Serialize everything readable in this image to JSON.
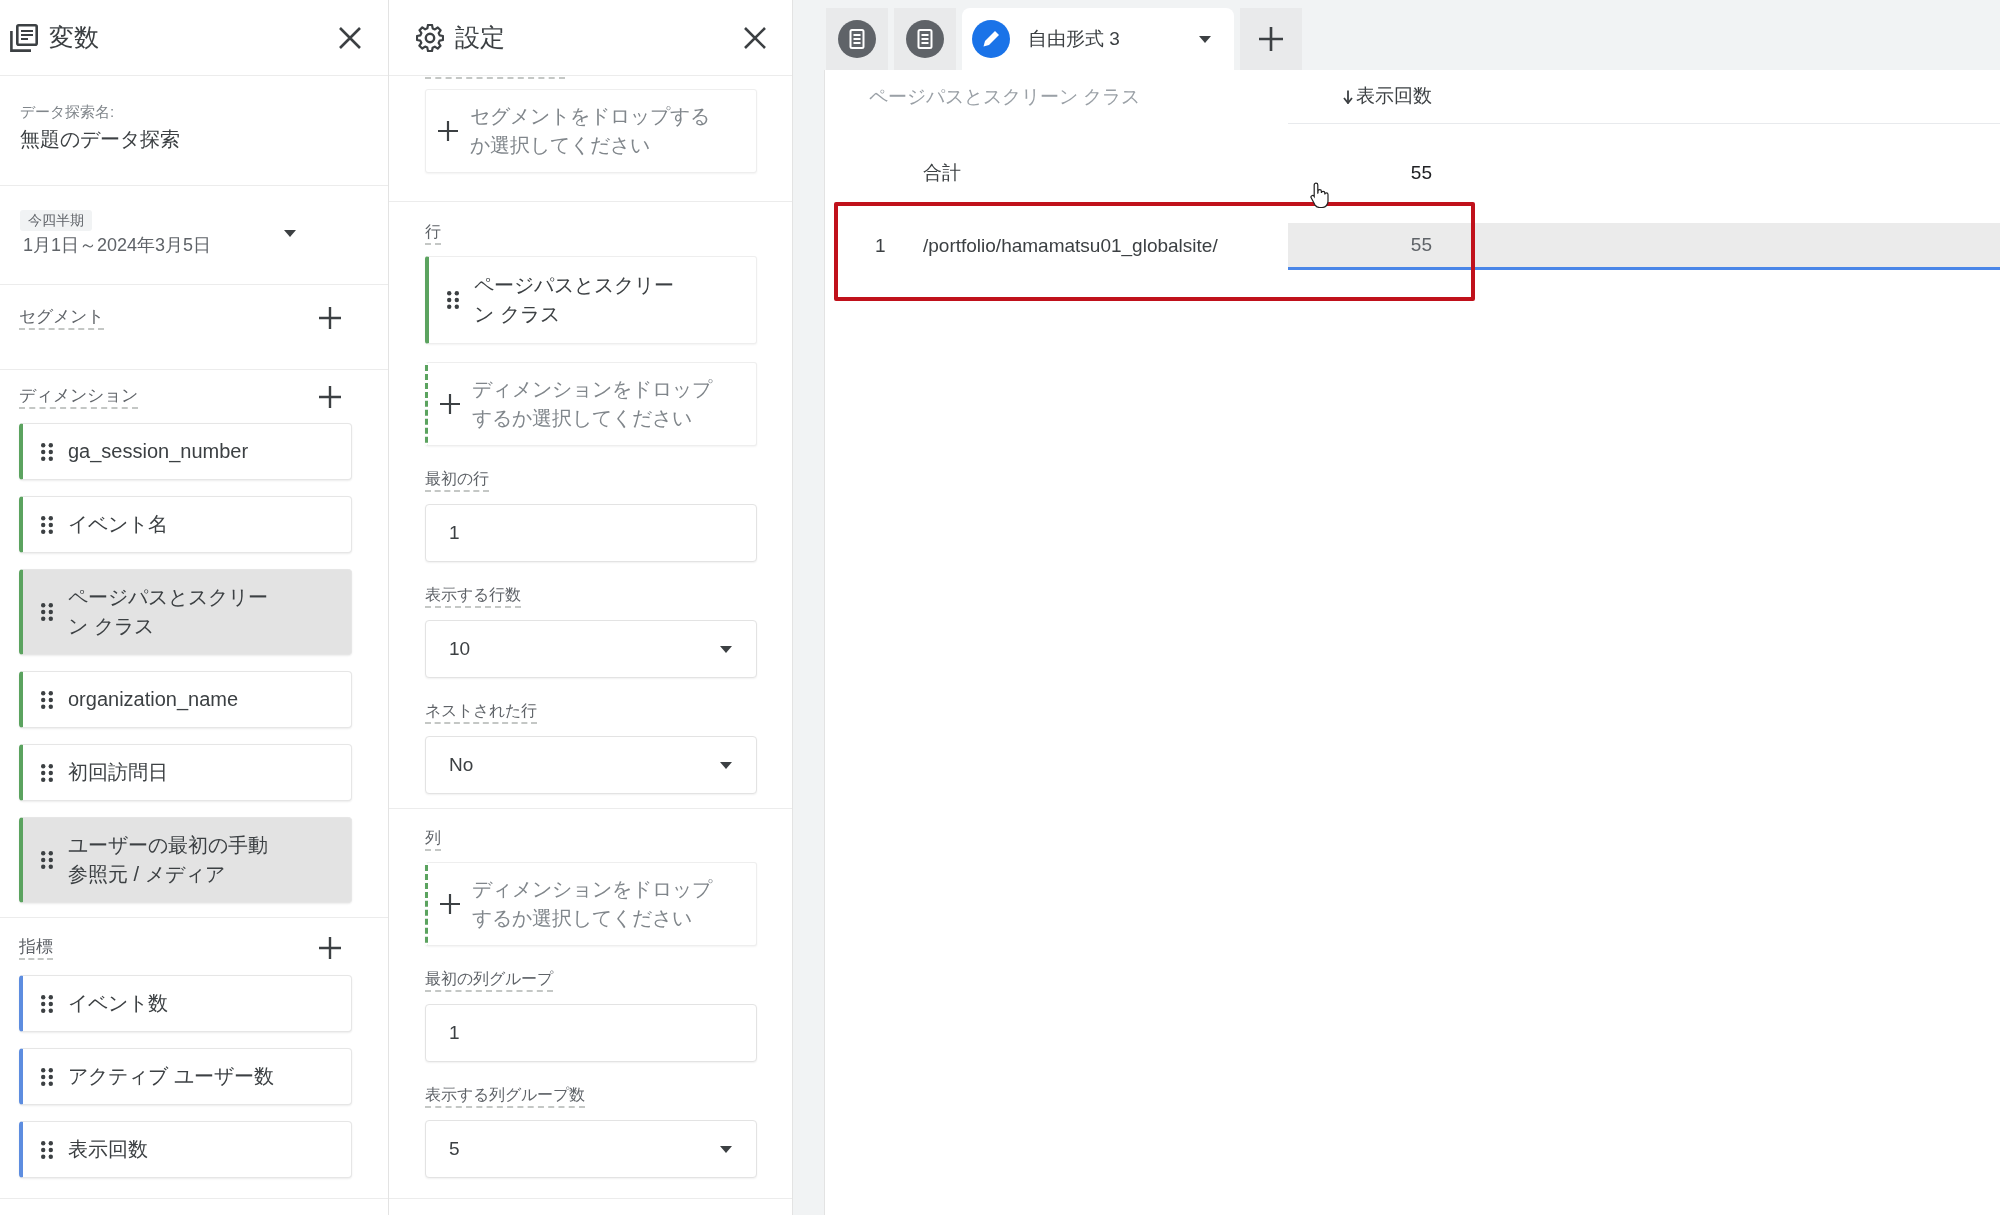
{
  "variables_panel": {
    "title": "変数",
    "exploration_name": {
      "label": "データ探索名:",
      "value": "無題のデータ探索"
    },
    "date_range": {
      "chip": "今四半期",
      "value": "1月1日～2024年3月5日"
    },
    "sections": [
      {
        "kind": "segment",
        "label": "セグメント"
      },
      {
        "kind": "dimension",
        "label": "ディメンション",
        "items": [
          {
            "label": "ga_session_number",
            "selected": false
          },
          {
            "label": "イベント名",
            "selected": false
          },
          {
            "label": "ページパスとスクリーン クラス",
            "selected": true
          },
          {
            "label": "organization_name",
            "selected": false
          },
          {
            "label": "初回訪問日",
            "selected": false
          },
          {
            "label": "ユーザーの最初の手動参照元 / メディア",
            "selected": true
          }
        ]
      },
      {
        "kind": "metric",
        "label": "指標",
        "items": [
          {
            "label": "イベント数",
            "selected": false
          },
          {
            "label": "アクティブ ユーザー数",
            "selected": false
          },
          {
            "label": "表示回数",
            "selected": false
          }
        ]
      }
    ]
  },
  "settings_panel": {
    "title": "設定",
    "sections": [
      {
        "drop_zones": [
          {
            "kind": "segment",
            "text": "セグメントをドロップするか選択してください"
          }
        ]
      },
      {
        "label": "行",
        "items": [
          {
            "kind": "dimension",
            "label": "ページパスとスクリーン クラス"
          }
        ],
        "drop_zones": [
          {
            "kind": "dimension",
            "text": "ディメンションをドロップするか選択してください"
          }
        ],
        "fields": [
          {
            "kind": "input",
            "label": "最初の行",
            "value": "1"
          },
          {
            "kind": "select",
            "label": "表示する行数",
            "value": "10"
          },
          {
            "kind": "select",
            "label": "ネストされた行",
            "value": "No"
          }
        ]
      },
      {
        "label": "列",
        "drop_zones": [
          {
            "kind": "dimension",
            "text": "ディメンションをドロップするか選択してください"
          }
        ],
        "fields": [
          {
            "kind": "input",
            "label": "最初の列グループ",
            "value": "1"
          },
          {
            "kind": "select",
            "label": "表示する列グループ数",
            "value": "5"
          }
        ]
      }
    ]
  },
  "tabs": [
    {
      "kind": "icon",
      "selected": false
    },
    {
      "kind": "icon",
      "selected": false
    },
    {
      "kind": "named",
      "label": "自由形式 3",
      "selected": true
    }
  ],
  "table": {
    "columns": [
      {
        "label": "ページパスとスクリーン クラス",
        "sorted": false
      },
      {
        "label": "表示回数",
        "sorted": true
      }
    ],
    "total": {
      "label": "合計",
      "value": "55"
    },
    "rows": [
      {
        "index": "1",
        "label": "/portfolio/hamamatsu01_globalsite/",
        "value": "55",
        "level": 1,
        "highlighted": true
      }
    ]
  }
}
